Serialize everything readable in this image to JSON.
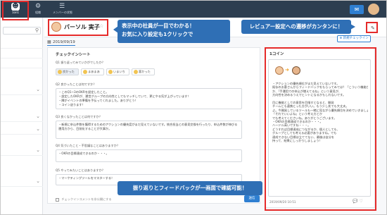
{
  "nav": {
    "items": [
      {
        "label": "1on1",
        "icon": "people-icon"
      },
      {
        "label": "組織",
        "icon": "org-icon"
      },
      {
        "label": "メンバーの状態",
        "icon": "member-icon"
      }
    ]
  },
  "user": {
    "name": "バーソル 実子"
  },
  "date_tab": "2019/09/19",
  "new_checkin_label": "新規チェックイン",
  "sheet": {
    "title": "チェックインシート",
    "q1": "Q1 振り返ってみていかがでしたか？",
    "moods": [
      "良かった",
      "まあまあ",
      "いまいち",
      "悪かった"
    ],
    "q2": "Q2 良かったことは何ですか？",
    "a2": [
      "・このQ1~3のOKRを設定したこと。",
      "・設定したOKRが、運営グループの方向性としてもマッチしていて、更にやる気が上がっています！",
      "・隣がイベントの準備を手伝ってくれました。ありがとう！",
      "・コイン送ります！"
    ],
    "q3": "Q3 良くなかったことは何ですか？",
    "a3": [
      "・新規に申込件数を獲得するためのアクションの優先度がまだ見えていないです。統合担当との意見交換を行ったり、申込件数が伸びる",
      "運用方から、目前化することが大事か。"
    ],
    "q4": "Q4 気づいたこと・不思議なことはありますか？",
    "a4": [
      "・OKRの目標達成できるのか・・・。"
    ],
    "q5": "Q5 やってみたいことはありますか？",
    "a5": [
      "・マーケティングツールをマスターする！"
    ],
    "checkbox_label": "チェックインコメントを非公開にする",
    "submit_label": "送信"
  },
  "coin": {
    "title": "1コイン",
    "text": [
      "・アクションの優先順位がまだ見えていないです。",
      "既存のお客さんからフィードバックをもらってみては？「こういう機能があればもっといいと",
      "か、「手運用での申込が増えてるね」という意見が、",
      "方向性を決めるうえでヒントになるかもしれないです。",
      "",
      "目に機能としての意思を目指すとなると、開発",
      "チームとも連携とった方がいい。もう少し先でも大丈夫。",
      "よ。今開発しているツールも一緒に見ながら優先順位を決めていきましょう。",
      "「それでいいよね」という考え方とか",
      "でも考えてくださいね。ありがとうございます。",
      "・OKRの目標達成できるのか・・・。",
      "ハードル高いですね・・・。",
      "どうすれば目標達成につながるか、個人としても、",
      "グループとしても考える必要がありますね。でも",
      "達成できない目標は立ててない、最後は自分を",
      "持って、結果にしっかりしましょう！"
    ],
    "footer_date": "2019/09/20 10:51"
  },
  "callouts": {
    "user": [
      "表示中の社員が一目でわかる！",
      "お気に入り設定も1クリックで"
    ],
    "reviewer": "レビュアー設定への遷移がカンタンに！",
    "feedback": "振り返りとフィードバックが一画面で確認可能！"
  },
  "colors": {
    "topbar": "#2d3e50",
    "accent": "#2f7fd1",
    "callout": "#2f6fb5",
    "highlight": "#e52a2a"
  }
}
